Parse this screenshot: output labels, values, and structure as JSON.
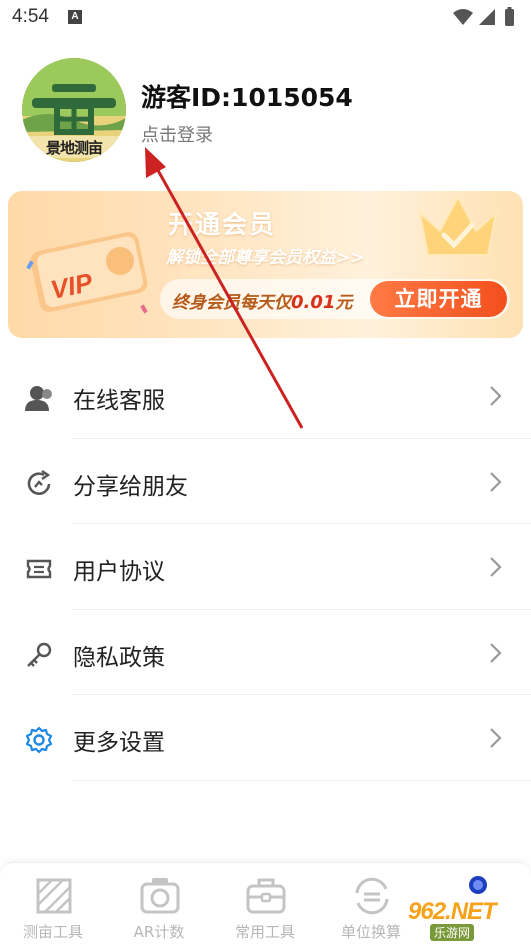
{
  "status_bar": {
    "time": "4:54",
    "notification_badge": "A"
  },
  "profile": {
    "avatar_label": "景地测亩",
    "user_id": "游客ID:1015054",
    "login_hint": "点击登录"
  },
  "vip": {
    "title": "开通会员",
    "subtitle": "解锁全部尊享会员权益>>",
    "price_prefix": "终身会员每天仅",
    "price_amount": "0.01",
    "price_suffix": "元",
    "button_label": "立即开通",
    "card_text": "VIP"
  },
  "menu": {
    "items": [
      {
        "label": "在线客服",
        "icon": "customer-service-icon"
      },
      {
        "label": "分享给朋友",
        "icon": "share-icon"
      },
      {
        "label": "用户协议",
        "icon": "agreement-icon"
      },
      {
        "label": "隐私政策",
        "icon": "key-icon"
      },
      {
        "label": "更多设置",
        "icon": "settings-icon"
      }
    ]
  },
  "bottom_nav": {
    "items": [
      {
        "label": "测亩工具",
        "icon": "measure-icon"
      },
      {
        "label": "AR计数",
        "icon": "camera-icon"
      },
      {
        "label": "常用工具",
        "icon": "toolbox-icon"
      },
      {
        "label": "单位换算",
        "icon": "convert-icon"
      },
      {
        "label": "",
        "icon": "profile-icon"
      }
    ]
  },
  "watermark": {
    "text": "962.NET",
    "subtext": "乐游网"
  },
  "colors": {
    "accent_blue": "#1e88e5",
    "vip_orange": "#f2501d",
    "arrow_red": "#cc2222"
  }
}
